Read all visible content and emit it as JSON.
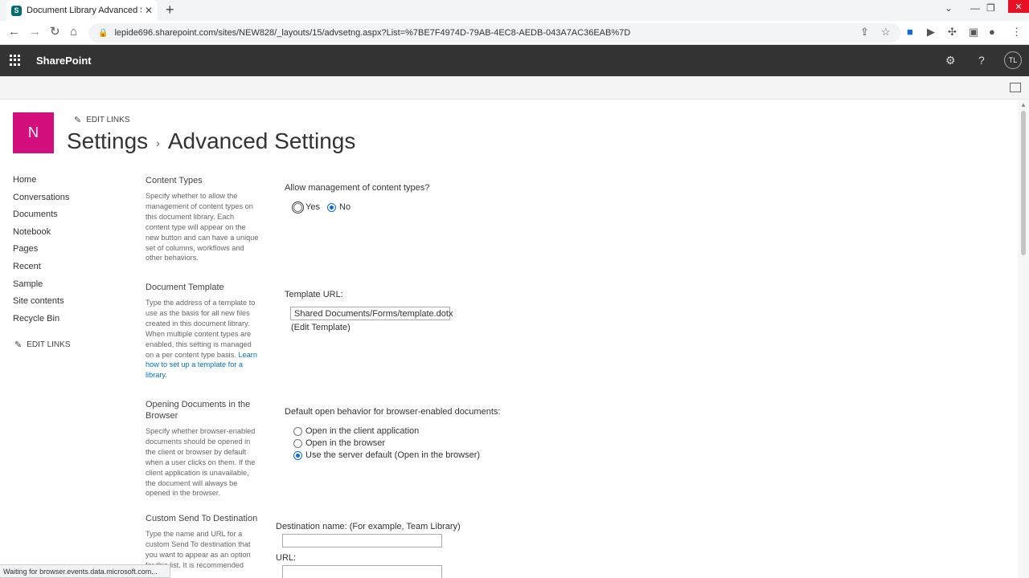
{
  "browser": {
    "tab_title": "Document Library Advanced Set",
    "tab_close": "✕",
    "new_tab": "+",
    "url": "lepide696.sharepoint.com/sites/NEW828/_layouts/15/advsetng.aspx?List=%7BE7F4974D-79AB-4EC8-AEDB-043A7AC36EAB%7D"
  },
  "suite": {
    "brand": "SharePoint",
    "avatar_initials": "TL",
    "settings_icon": "gear-icon",
    "help_icon": "question-icon"
  },
  "site": {
    "logo_letter": "N",
    "edit_links": "EDIT LINKS",
    "breadcrumb_root": "Settings",
    "breadcrumb_sep": "›",
    "page_title": "Advanced Settings"
  },
  "nav": {
    "items": [
      "Home",
      "Conversations",
      "Documents",
      "Notebook",
      "Pages",
      "Recent",
      "Sample",
      "Site contents",
      "Recycle Bin"
    ],
    "edit_links": "EDIT LINKS"
  },
  "sections": {
    "content_types": {
      "title": "Content Types",
      "desc": "Specify whether to allow the management of content types on this document library. Each content type will appear on the new button and can have a unique set of columns, workflows and other behaviors.",
      "question": "Allow management of content types?",
      "yes": "Yes",
      "no": "No",
      "selected": "No"
    },
    "document_template": {
      "title": "Document Template",
      "desc": "Type the address of a template to use as the basis for all new files created in this document library. When multiple content types are enabled, this setting is managed on a per content type basis. ",
      "link": "Learn how to set up a template for a library.",
      "label": "Template URL:",
      "value": "Shared Documents/Forms/template.dotx",
      "edit_link": "(Edit Template)"
    },
    "opening_documents": {
      "title": "Opening Documents in the Browser",
      "desc": "Specify whether browser-enabled documents should be opened in the client or browser by default when a user clicks on them. If the client application is unavailable, the document will always be opened in the browser.",
      "question": "Default open behavior for browser-enabled documents:",
      "options": [
        "Open in the client application",
        "Open in the browser",
        "Use the server default (Open in the browser)"
      ],
      "selected_index": 2
    },
    "send_to": {
      "title": "Custom Send To Destination",
      "desc": "Type the name and URL for a custom Send To destination that you want to appear as an option for this list. It is recommended",
      "dest_label": "Destination name: (For example, Team Library)",
      "url_label": "URL:",
      "dest_value": "",
      "url_value": ""
    }
  },
  "status": "Waiting for browser.events.data.microsoft.com..."
}
